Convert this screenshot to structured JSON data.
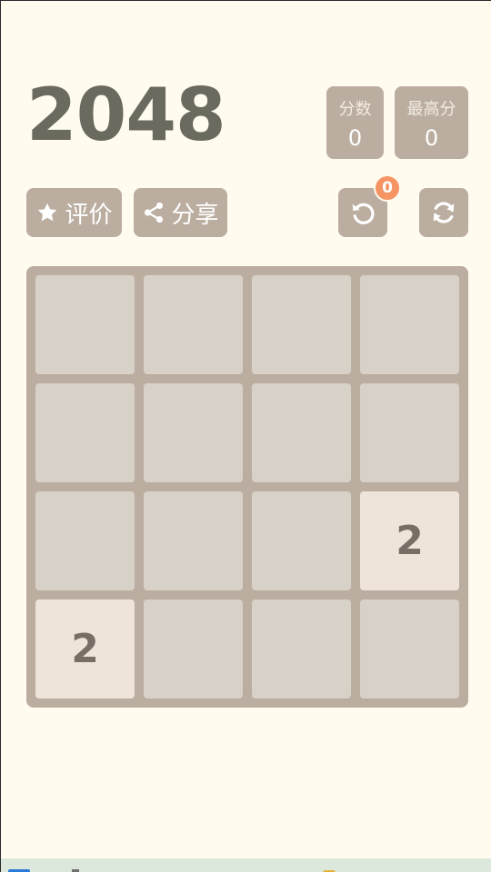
{
  "header": {
    "title": "2048",
    "score_label": "分数",
    "score_value": "0",
    "best_label": "最高分",
    "best_value": "0"
  },
  "actions": {
    "rate_label": "评价",
    "share_label": "分享",
    "undo_badge": "0"
  },
  "icons": {
    "rate": "star-icon",
    "share": "share-icon",
    "undo": "undo-icon",
    "restart": "refresh-icon"
  },
  "colors": {
    "background": "#fffbef",
    "board": "#bbada0",
    "empty_cell": "#d8d1c7",
    "tile_2": "#eee4da",
    "tile_text": "#776e65",
    "title": "#6b6a5e",
    "badge": "#f59563"
  },
  "board": {
    "grid": [
      [
        "",
        "",
        "",
        ""
      ],
      [
        "",
        "",
        "",
        ""
      ],
      [
        "",
        "",
        "",
        "2"
      ],
      [
        "2",
        "",
        "",
        ""
      ]
    ]
  }
}
